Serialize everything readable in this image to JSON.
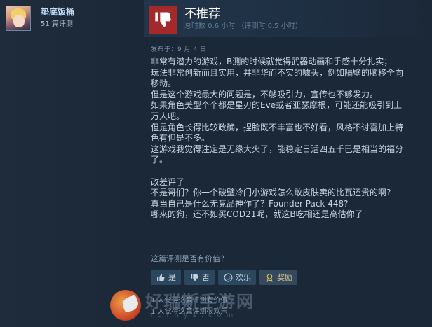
{
  "author": {
    "name": "垫底饭桶",
    "review_count": "51 篇评测"
  },
  "review": {
    "verdict": "不推荐",
    "hours": "总时数 0.6 小时 （评测时 0.5 小时）",
    "posted": "发布于：9 月 4 日",
    "lines": [
      "非常有潜力的游戏，B测的时候就觉得武器动画和手感十分扎实；",
      "玩法非常创新而且实用，并非华而不实的噱头，例如隔壁的脑移全向",
      "移动。",
      "但是这个游戏最大的问题是，不够吸引力，宣传也不够发力。",
      "如果角色美型个个都是星刃的Eve或者亚瑟摩根，可能还能吸引到上",
      "万人吧。",
      "但是角色长得比较政确，捏脸既不丰富也不好看，风格不讨喜加上特",
      "色有但是不多。",
      "这游戏我觉得注定是无缘大火了，能稳定日活四五千已是相当的福分",
      "了。",
      "",
      "改差评了",
      "不是哥们？你一个破壁冷门小游戏怎么敢皮肤卖的比瓦还贵的啊?",
      "真当自己是什么无竞品神作了？Founder Pack 448?",
      "哪来的狗，还不如买COD21呢，就这B吃相还是高估你了"
    ]
  },
  "helpful": {
    "question": "这篇评测是否有价值？",
    "yes": "是",
    "no": "否",
    "funny": "欢乐",
    "award": "奖励",
    "stat_helpful": "1 人觉得这篇评测有价值",
    "stat_funny": "1 人觉得这篇评测很欢乐"
  },
  "watermark": {
    "cn": "好瑞斯手游网",
    "en": "horhys.com"
  },
  "colors": {
    "background": "#1b2838",
    "not_recommended": "#a3292a",
    "button": "#2a475e"
  }
}
